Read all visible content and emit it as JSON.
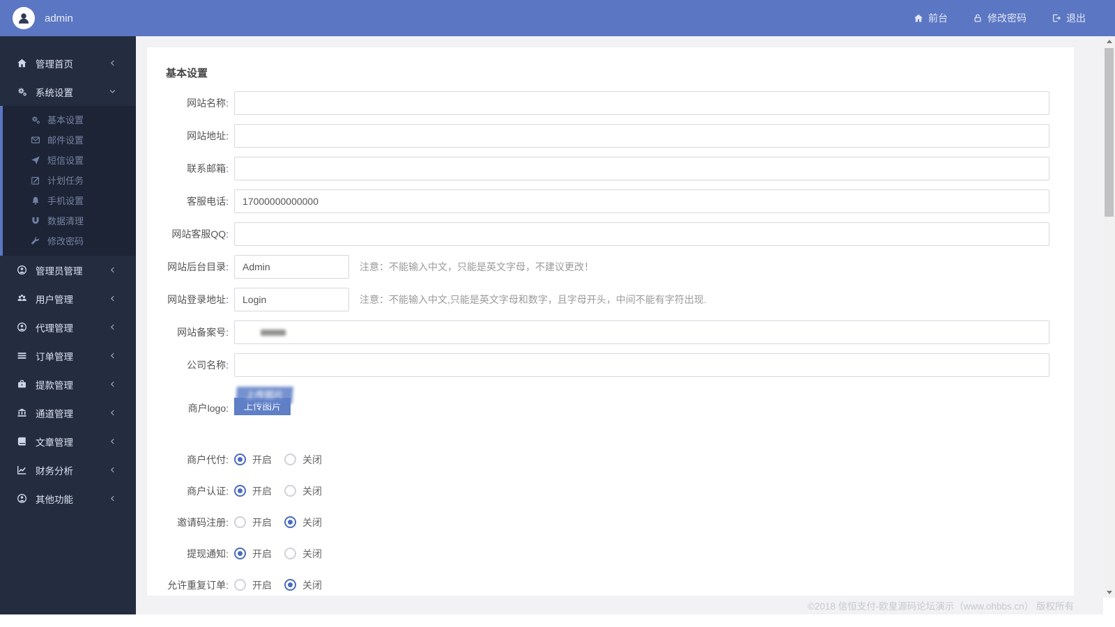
{
  "header": {
    "user": "admin",
    "nav_frontend": "前台",
    "nav_change_password": "修改密码",
    "nav_logout": "退出"
  },
  "sidebar": {
    "items": [
      {
        "label": "管理首页"
      },
      {
        "label": "系统设置"
      },
      {
        "label": "管理员管理"
      },
      {
        "label": "用户管理"
      },
      {
        "label": "代理管理"
      },
      {
        "label": "订单管理"
      },
      {
        "label": "提款管理"
      },
      {
        "label": "通道管理"
      },
      {
        "label": "文章管理"
      },
      {
        "label": "财务分析"
      },
      {
        "label": "其他功能"
      }
    ],
    "system_submenu": [
      {
        "label": "基本设置"
      },
      {
        "label": "邮件设置"
      },
      {
        "label": "短信设置"
      },
      {
        "label": "计划任务"
      },
      {
        "label": "手机设置"
      },
      {
        "label": "数据清理"
      },
      {
        "label": "修改密码"
      }
    ]
  },
  "main": {
    "title": "基本设置",
    "fields": [
      {
        "label": "网站名称:",
        "value": ""
      },
      {
        "label": "网站地址:",
        "value": ""
      },
      {
        "label": "联系邮箱:",
        "value": ""
      },
      {
        "label": "客服电话:",
        "value": "17000000000000"
      },
      {
        "label": "网站客服QQ:",
        "value": ""
      },
      {
        "label": "网站后台目录:",
        "value": "Admin",
        "note": "注意：不能输入中文，只能是英文字母，不建议更改！"
      },
      {
        "label": "网站登录地址:",
        "value": "Login",
        "note": "注意：不能输入中文,只能是英文字母和数字，且字母开头，中间不能有字符出现."
      },
      {
        "label": "网站备案号:",
        "value": ""
      },
      {
        "label": "公司名称:",
        "value": ""
      }
    ],
    "logo_field": {
      "label": "商户logo:",
      "upload_button": "上传图片"
    },
    "radios": [
      {
        "label": "商户代付:",
        "on": "开启",
        "off": "关闭",
        "selected": "on"
      },
      {
        "label": "商户认证:",
        "on": "开启",
        "off": "关闭",
        "selected": "on"
      },
      {
        "label": "邀请码注册:",
        "on": "开启",
        "off": "关闭",
        "selected": "off"
      },
      {
        "label": "提现通知:",
        "on": "开启",
        "off": "关闭",
        "selected": "on"
      },
      {
        "label": "允许重复订单:",
        "on": "开启",
        "off": "关闭",
        "selected": "off"
      }
    ]
  },
  "footer": {
    "copyright": "©2018 信恒支付-欧皇源码论坛演示（www.ohbbs.cn） 版权所有"
  },
  "colors": {
    "header": "#5b76c2",
    "sidebar": "#242c40",
    "accent": "#5f7fc6",
    "radio_selected": "#4a6bbf"
  }
}
